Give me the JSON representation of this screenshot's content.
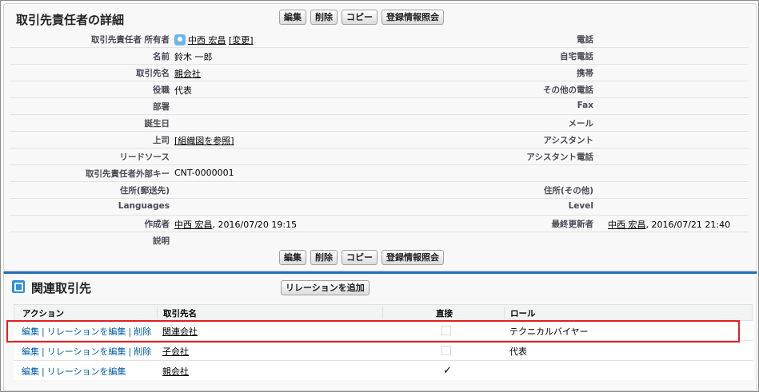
{
  "detail": {
    "title": "取引先責任者の詳細",
    "buttons": {
      "edit": "編集",
      "delete": "削除",
      "copy": "コピー",
      "lookup": "登録情報照会"
    },
    "owner": {
      "label": "取引先責任者 所有者",
      "value": "中西 宏昌",
      "change": "[変更]"
    },
    "phone_label": "電話",
    "name": {
      "label": "名前",
      "value": "鈴木 一郎"
    },
    "home_phone_label": "自宅電話",
    "account": {
      "label": "取引先名",
      "value": "親会社"
    },
    "mobile_label": "携帯",
    "title_field": {
      "label": "役職",
      "value": "代表"
    },
    "other_phone_label": "その他の電話",
    "department_label": "部署",
    "fax_label": "Fax",
    "birthday_label": "誕生日",
    "email_label": "メール",
    "reports_to": {
      "label": "上司",
      "value": "[組織図を参照]"
    },
    "assistant_label": "アシスタント",
    "lead_source_label": "リードソース",
    "assistant_phone_label": "アシスタント電話",
    "external_id": {
      "label": "取引先責任者外部キー",
      "value": "CNT-0000001"
    },
    "mailing_address_label": "住所(郵送先)",
    "other_address_label": "住所(その他)",
    "languages_label": "Languages",
    "level_label": "Level",
    "created_by": {
      "label": "作成者",
      "user": "中西 宏昌",
      "date": ", 2016/07/20 19:15"
    },
    "modified_by": {
      "label": "最終更新者",
      "user": "中西 宏昌",
      "date": ", 2016/07/21 21:40"
    },
    "description_label": "説明"
  },
  "related": {
    "title": "関連取引先",
    "add_button": "リレーションを追加",
    "headers": {
      "action": "アクション",
      "account": "取引先名",
      "direct": "直接",
      "role": "ロール"
    },
    "rows": [
      {
        "edit": "編集",
        "edit_rel": "リレーションを編集",
        "delete": "削除",
        "account": "関連会社",
        "direct": false,
        "role": "テクニカルバイヤー"
      },
      {
        "edit": "編集",
        "edit_rel": "リレーションを編集",
        "delete": "削除",
        "account": "子会社",
        "direct": false,
        "role": "代表"
      },
      {
        "edit": "編集",
        "edit_rel": "リレーションを編集",
        "account": "親会社",
        "direct": true,
        "check": "✓",
        "role": ""
      }
    ]
  }
}
